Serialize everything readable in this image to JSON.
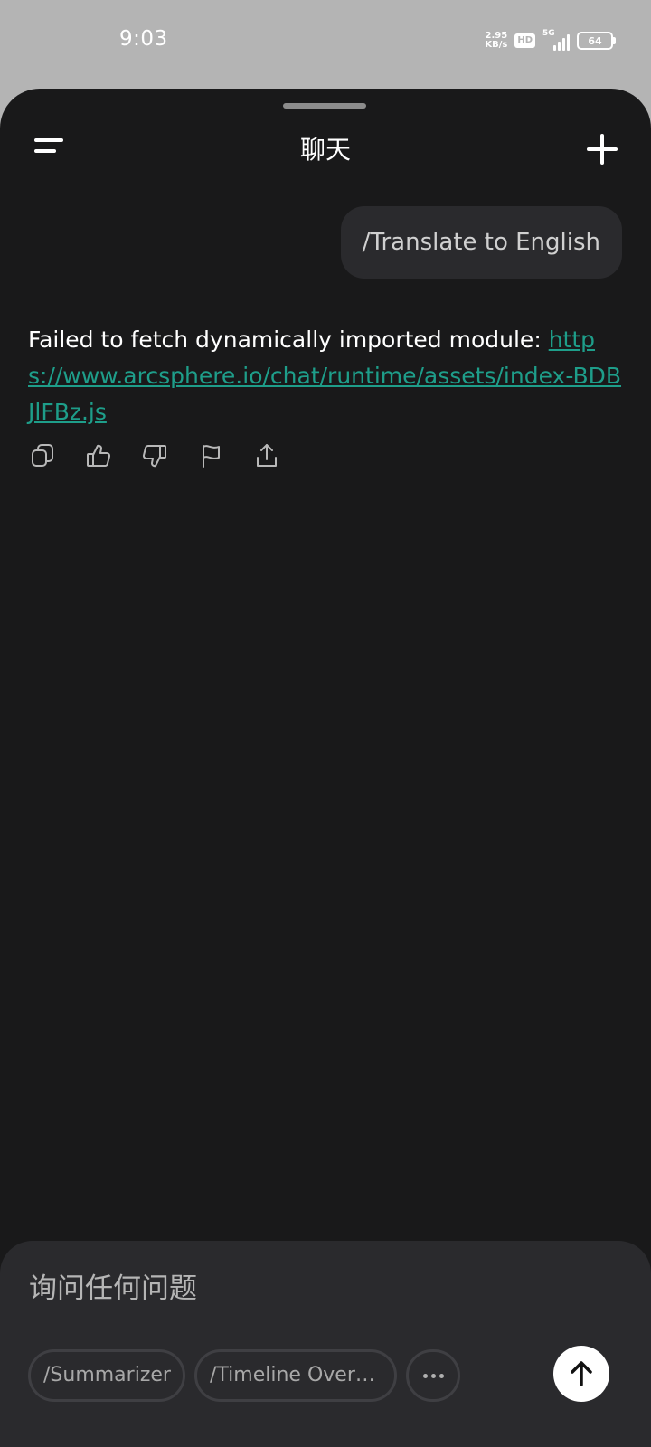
{
  "status_bar": {
    "time": "9:03",
    "net_speed_value": "2.95",
    "net_speed_unit": "KB/s",
    "hd_label": "HD",
    "network_label": "5G",
    "battery": "64"
  },
  "header": {
    "title": "聊天",
    "menu_icon": "menu-lines-icon",
    "new_chat_icon": "plus-icon"
  },
  "messages": {
    "user": "/Translate to English",
    "assistant_text": "Failed to fetch dynamically imported module: ",
    "assistant_link": "https://www.arcsphere.io/chat/runtime/assets/index-BDBJlFBz.js",
    "actions": [
      "copy-icon",
      "thumbs-up-icon",
      "thumbs-down-icon",
      "flag-icon",
      "share-icon"
    ]
  },
  "composer": {
    "placeholder": "询问任何问题",
    "chips": [
      "/Summarizer",
      "/Timeline Overv…"
    ],
    "more_icon": "more-dots-icon",
    "send_icon": "arrow-up-icon"
  },
  "colors": {
    "background": "#19191a",
    "bubble": "#2a2a2d",
    "link": "#1e9e8a",
    "status_bar": "#b4b4b4"
  }
}
